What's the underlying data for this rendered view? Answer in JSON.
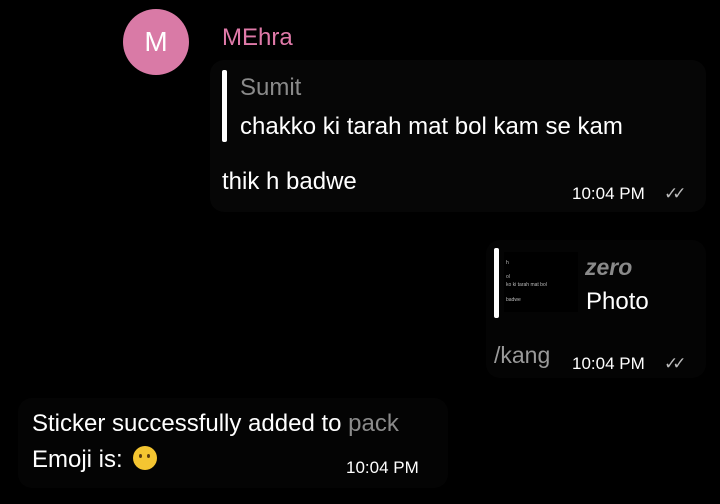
{
  "messages": {
    "incoming": {
      "avatar_initial": "M",
      "sender": "MEhra",
      "reply_to_sender": "Sumit",
      "reply_to_text": "chakko ki tarah mat bol kam se kam",
      "text": "thik h badwe",
      "time": "10:04 PM"
    },
    "outgoing": {
      "reply_to_sender": "zero",
      "reply_to_text": "Photo",
      "thumbnail_text": [
        "h",
        "ol",
        "ko ki tarah mat bol",
        "badwe"
      ],
      "text": "/kang",
      "time": "10:04 PM"
    },
    "bot": {
      "line1": "Sticker successfully added to",
      "link": "pack",
      "line2": "Emoji is:",
      "emoji": "thinking-face",
      "time": "10:04 PM"
    }
  },
  "colors": {
    "background": "#000000",
    "sender_name": "#e07aa9",
    "avatar": "#d97aa6",
    "muted_text": "#8a8a8a"
  }
}
